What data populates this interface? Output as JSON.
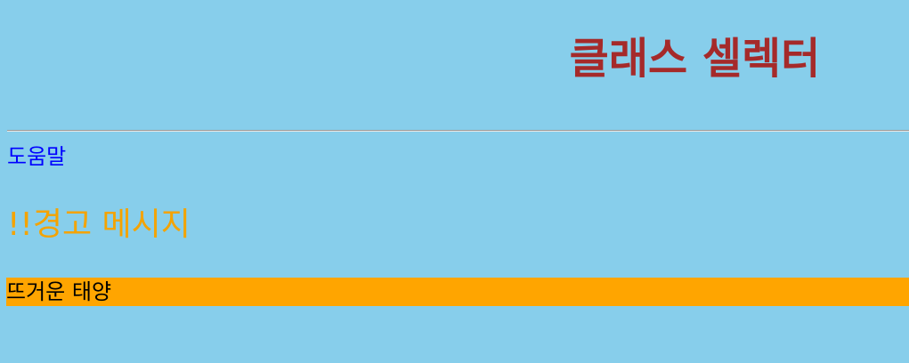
{
  "heading": {
    "title": "클래스 셀렉터"
  },
  "content": {
    "help_text": "도움말",
    "warning_text": "!!경고 메시지",
    "sun_text": "뜨거운 태양"
  },
  "colors": {
    "background": "#87ceeb",
    "title": "#a52a2a",
    "help": "#0000ff",
    "warning": "#f4a300",
    "highlight_background": "#ffa500"
  }
}
